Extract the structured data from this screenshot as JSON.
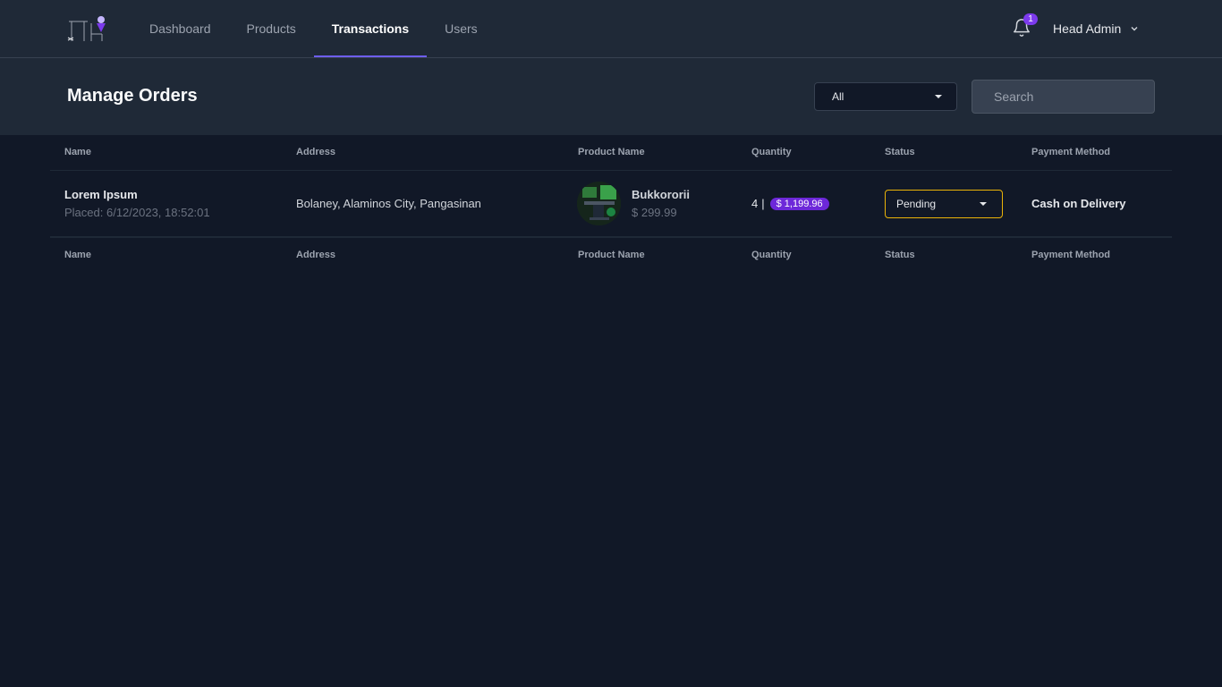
{
  "nav": {
    "links": [
      {
        "label": "Dashboard",
        "active": false
      },
      {
        "label": "Products",
        "active": false
      },
      {
        "label": "Transactions",
        "active": true
      },
      {
        "label": "Users",
        "active": false
      }
    ],
    "notification_count": "1",
    "user_name": "Head Admin",
    "icons": {
      "bell": "bell-icon",
      "user_menu": "chevron-down-icon",
      "logo": "logo-icon"
    }
  },
  "header": {
    "title": "Manage Orders",
    "filter": {
      "selected": "All"
    },
    "search": {
      "placeholder": "Search",
      "value": ""
    }
  },
  "table": {
    "columns": [
      "Name",
      "Address",
      "Product Name",
      "Quantity",
      "Status",
      "Payment Method"
    ],
    "rows": [
      {
        "name": "Lorem Ipsum",
        "placed": "Placed: 6/12/2023, 18:52:01",
        "address": "Bolaney, Alaminos City, Pangasinan",
        "product_name": "Bukkororii",
        "product_price": "$ 299.99",
        "quantity": "4",
        "total": "$ 1,199.96",
        "status": "Pending",
        "payment_method": "Cash on Delivery"
      }
    ]
  },
  "colors": {
    "accent": "#6d5ef0",
    "badge": "#6d28d9",
    "pending_border": "#eab308",
    "background": "#111827",
    "panel": "#1f2937"
  }
}
